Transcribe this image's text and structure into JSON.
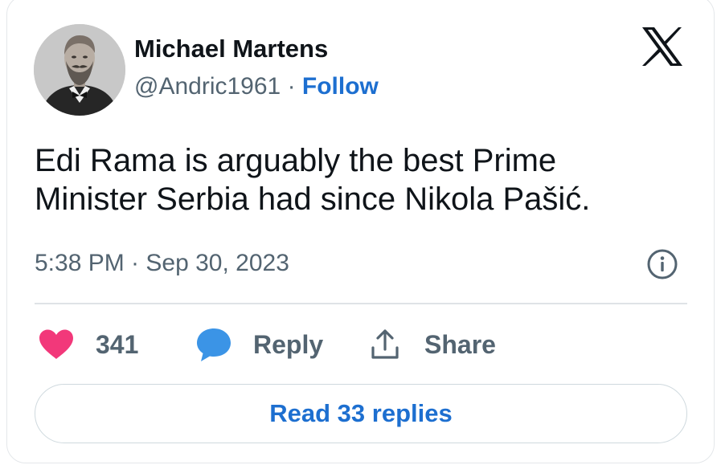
{
  "tweet": {
    "author_name": "Michael Martens",
    "handle": "@Andric1961",
    "separator": " · ",
    "follow_label": "Follow",
    "text": "Edi Rama is arguably the best Prime Minister Serbia had since Nikola Pašić.",
    "timestamp": "5:38 PM · Sep 30, 2023"
  },
  "actions": {
    "like_count": "341",
    "reply_label": "Reply",
    "share_label": "Share"
  },
  "read_replies_label": "Read 33 replies",
  "icons": {
    "brand": "x-logo-icon",
    "info": "info-icon",
    "like": "heart-icon",
    "reply": "speech-bubble-icon",
    "share": "share-upload-icon"
  },
  "colors": {
    "like": "#f2387a",
    "reply": "#3b94e6",
    "link": "#1d6fd0",
    "text_secondary": "#536471"
  }
}
